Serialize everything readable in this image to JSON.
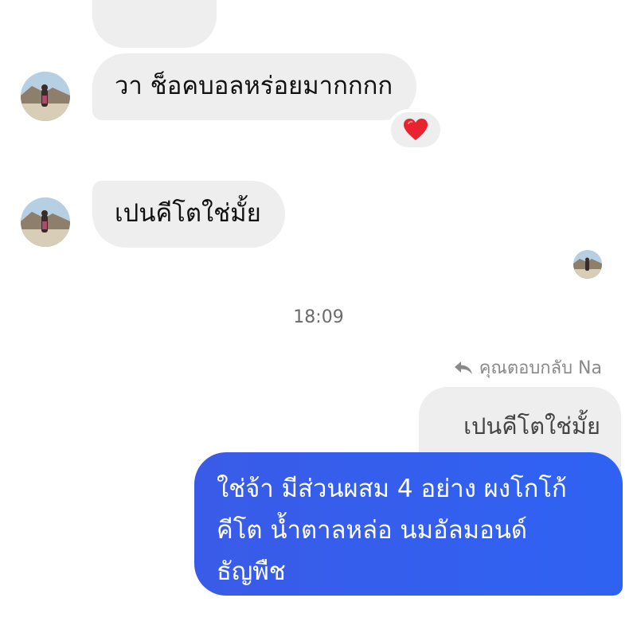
{
  "conversation": {
    "messages_in": [
      {
        "text": "วา ช็อคบอลหร่อยมากกกก",
        "reaction": "heart-icon"
      },
      {
        "text": "เปนคีโตใช่มั้ย"
      }
    ],
    "timestamp": "18:09",
    "reply": {
      "label": "คุณตอบกลับ Na",
      "quoted_text": "เปนคีโตใช่มั้ย"
    },
    "message_out": {
      "lines": [
        "ใช่จ้า มีส่วนผสม 4 อย่าง  ผงโกโก้",
        "คีโต  น้ำตาลหล่อ  นมอัลมอนด์",
        "ธัญพืช"
      ]
    }
  },
  "colors": {
    "incoming_bubble": "#eeeeef",
    "outgoing_bubble": "#2f62f2",
    "heart": "#e8232f",
    "timestamp_text": "#6b6b6b"
  }
}
